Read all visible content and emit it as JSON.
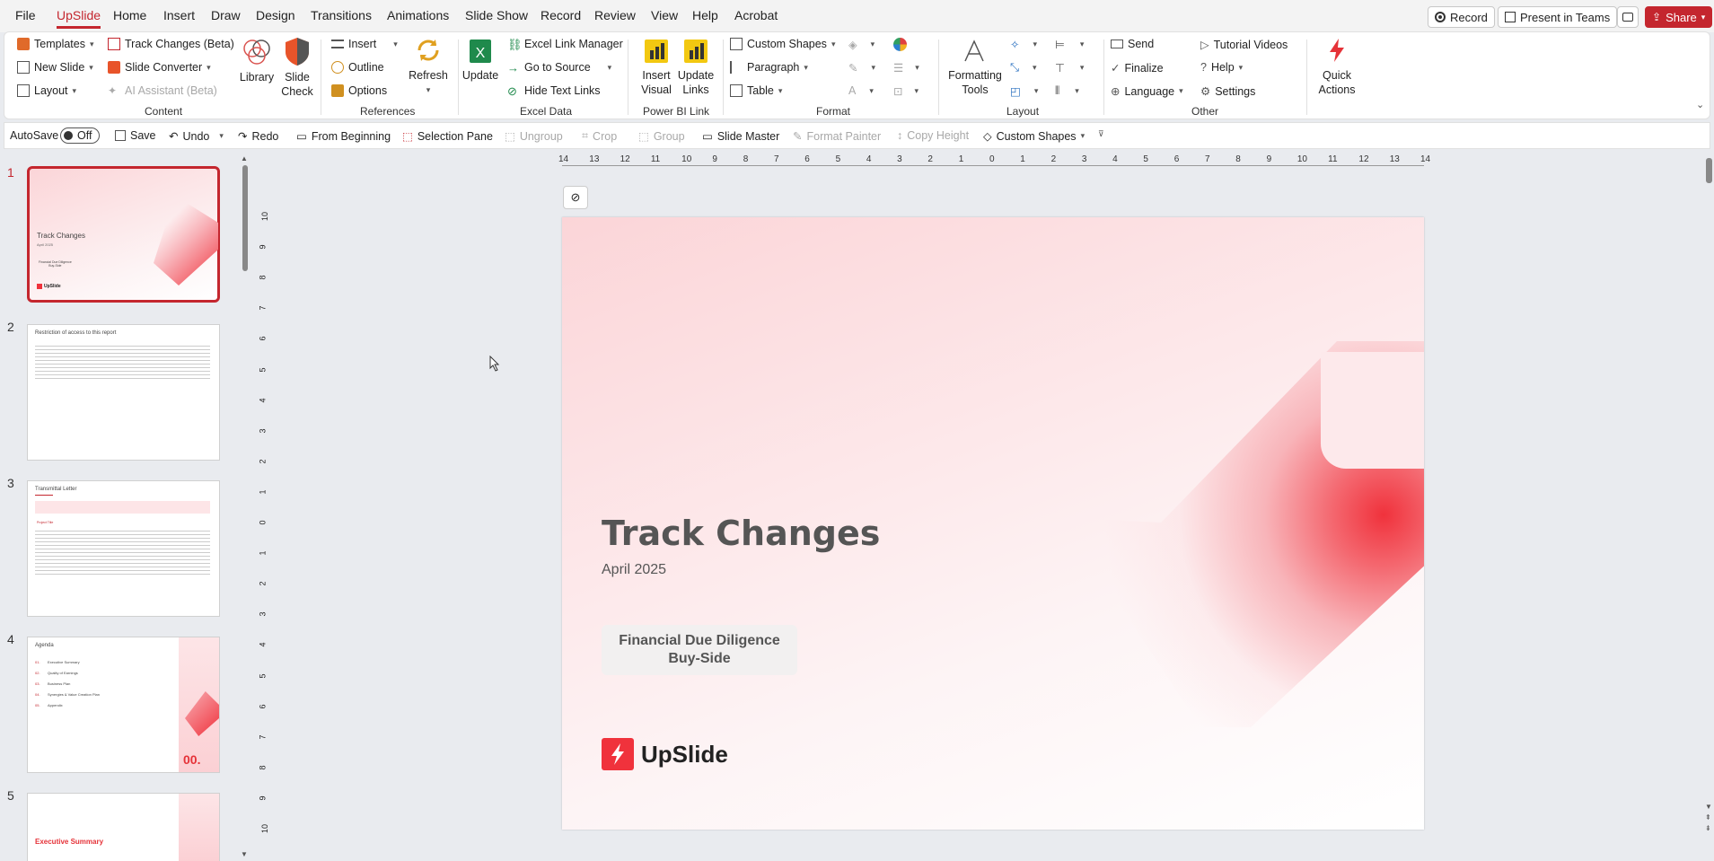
{
  "menu": [
    "File",
    "UpSlide",
    "Home",
    "Insert",
    "Draw",
    "Design",
    "Transitions",
    "Animations",
    "Slide Show",
    "Record",
    "Review",
    "View",
    "Help",
    "Acrobat"
  ],
  "menu_active": "UpSlide",
  "top_buttons": {
    "record": "Record",
    "present": "Present in Teams",
    "share": "Share"
  },
  "ribbon": {
    "content": {
      "templates": "Templates",
      "track_changes": "Track Changes (Beta)",
      "new_slide": "New Slide",
      "slide_converter": "Slide Converter",
      "layout": "Layout",
      "ai_assistant": "AI Assistant (Beta)",
      "library": "Library",
      "slide_check_1": "Slide",
      "slide_check_2": "Check",
      "label": "Content"
    },
    "references": {
      "insert": "Insert",
      "outline": "Outline",
      "options": "Options",
      "refresh": "Refresh",
      "label": "References"
    },
    "excel": {
      "update": "Update",
      "link_manager": "Excel Link Manager",
      "go_to_source": "Go to Source",
      "hide_text_links": "Hide Text Links",
      "label": "Excel Data"
    },
    "powerbi": {
      "insert_visual_1": "Insert",
      "insert_visual_2": "Visual",
      "update_links_1": "Update",
      "update_links_2": "Links",
      "label": "Power BI Link"
    },
    "format": {
      "custom_shapes": "Custom Shapes",
      "paragraph": "Paragraph",
      "table": "Table",
      "label": "Format"
    },
    "layout": {
      "formatting_tools_1": "Formatting",
      "formatting_tools_2": "Tools",
      "label": "Layout"
    },
    "other": {
      "send": "Send",
      "finalize": "Finalize",
      "language": "Language",
      "tutorial_videos": "Tutorial Videos",
      "help": "Help",
      "settings": "Settings",
      "quick_actions_1": "Quick",
      "quick_actions_2": "Actions",
      "label": "Other"
    }
  },
  "qat": {
    "autosave": "AutoSave",
    "autosave_state": "Off",
    "save": "Save",
    "undo": "Undo",
    "redo": "Redo",
    "from_beginning": "From Beginning",
    "selection_pane": "Selection Pane",
    "ungroup": "Ungroup",
    "crop": "Crop",
    "group": "Group",
    "slide_master": "Slide Master",
    "format_painter": "Format Painter",
    "copy_height": "Copy Height",
    "custom_shapes": "Custom Shapes"
  },
  "thumbnails": [
    {
      "num": "1",
      "title": "Track Changes",
      "sub": "April 2025",
      "box1": "Financial Due Diligence",
      "box2": "Buy-Side",
      "logo": "UpSlide"
    },
    {
      "num": "2",
      "title": "Restriction of access to this report"
    },
    {
      "num": "3",
      "title": "Transmittal Letter",
      "sub": "Project Title"
    },
    {
      "num": "4",
      "title": "Agenda",
      "items": [
        "01.",
        "Executive Summary",
        "02.",
        "Quality of Earnings",
        "03.",
        "Business Plan",
        "04.",
        "Synergies & Value Creation Plan",
        "05.",
        "Appendix"
      ],
      "big": "00."
    },
    {
      "num": "5",
      "title": "Executive Summary"
    }
  ],
  "ruler_h": [
    "14",
    "13",
    "12",
    "11",
    "10",
    "9",
    "8",
    "7",
    "6",
    "5",
    "4",
    "3",
    "2",
    "1",
    "0",
    "1",
    "2",
    "3",
    "4",
    "5",
    "6",
    "7",
    "8",
    "9",
    "10",
    "11",
    "12",
    "13",
    "14"
  ],
  "ruler_v": [
    "10",
    "9",
    "8",
    "7",
    "6",
    "5",
    "4",
    "3",
    "2",
    "1",
    "0",
    "1",
    "2",
    "3",
    "4",
    "5",
    "6",
    "7",
    "8",
    "9",
    "10"
  ],
  "slide": {
    "title": "Track Changes",
    "date": "April 2025",
    "box_line1": "Financial Due Diligence",
    "box_line2": "Buy-Side",
    "logo_text": "UpSlide"
  },
  "colors": {
    "accent": "#c4262e",
    "brand_red": "#f0323c",
    "slide_pink": "#fbd5d8"
  }
}
